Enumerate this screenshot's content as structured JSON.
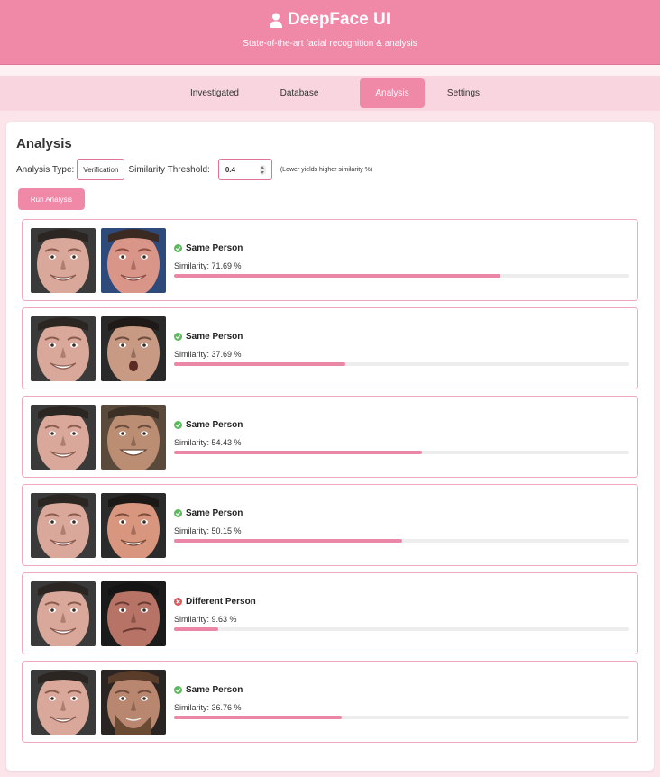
{
  "header": {
    "title": "DeepFace UI",
    "subtitle": "State-of-the-art facial recognition & analysis",
    "icon": "user-icon"
  },
  "nav": {
    "tabs": [
      {
        "label": "Investigated",
        "active": false
      },
      {
        "label": "Database",
        "active": false
      },
      {
        "label": "Analysis",
        "active": true
      },
      {
        "label": "Settings",
        "active": false
      }
    ]
  },
  "analysis": {
    "title": "Analysis",
    "type_label": "Analysis Type:",
    "type_value": "Verification",
    "threshold_label": "Similarity Threshold:",
    "threshold_value": "0.4",
    "threshold_hint": "(Lower yields higher similarity %)",
    "run_button": "Run Analysis"
  },
  "results": [
    {
      "verdict": "Same Person",
      "similarity_text": "Similarity: 71.69 %",
      "similarity": 71.69,
      "match": true
    },
    {
      "verdict": "Same Person",
      "similarity_text": "Similarity: 37.69 %",
      "similarity": 37.69,
      "match": true
    },
    {
      "verdict": "Same Person",
      "similarity_text": "Similarity: 54.43 %",
      "similarity": 54.43,
      "match": true
    },
    {
      "verdict": "Same Person",
      "similarity_text": "Similarity: 50.15 %",
      "similarity": 50.15,
      "match": true
    },
    {
      "verdict": "Different Person",
      "similarity_text": "Similarity: 9.63 %",
      "similarity": 9.63,
      "match": false
    },
    {
      "verdict": "Same Person",
      "similarity_text": "Similarity: 36.76 %",
      "similarity": 36.76,
      "match": true
    }
  ],
  "colors": {
    "accent": "#f088a8",
    "match": "#5cb85c",
    "nomatch": "#e0565b",
    "bar": "#ea86a6"
  }
}
